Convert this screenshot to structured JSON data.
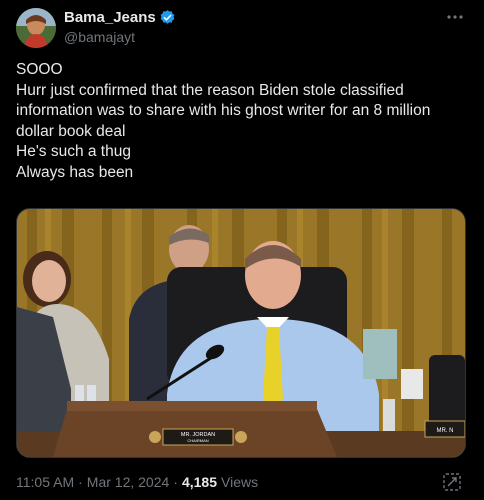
{
  "author": {
    "display_name": "Bama_Jeans",
    "handle": "@bamajayt",
    "verified": true
  },
  "tweet": {
    "lines": [
      "SOOO",
      "Hurr just confirmed that the reason Biden stole classified",
      "information was to share with his ghost writer for an 8 million",
      "dollar book deal",
      "He's such a thug",
      "Always has been"
    ]
  },
  "media": {
    "nameplate_line1": "MR. JORDAN",
    "nameplate_line2": "CHAIRMAN",
    "side_nameplate": "MR. N"
  },
  "footer": {
    "time": "11:05 AM",
    "separator": "·",
    "date": "Mar 12, 2024",
    "views_count": "4,185",
    "views_label": "Views"
  },
  "colors": {
    "background": "#000000",
    "text_primary": "#e7e9ea",
    "text_secondary": "#71767b",
    "verified_blue": "#1d9bf0"
  },
  "icons": {
    "more": "more-dots-icon",
    "verified": "verified-badge-icon",
    "grok": "grok-icon"
  }
}
